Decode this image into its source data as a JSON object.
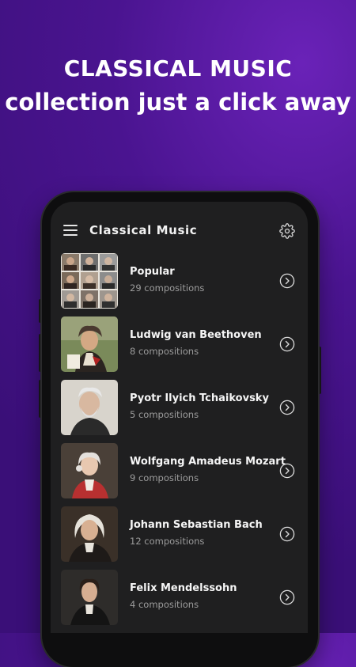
{
  "promo": {
    "headline": "CLASSICAL MUSIC",
    "subheadline": "collection just a click away"
  },
  "app": {
    "title": "Classical Music",
    "menu_icon": "hamburger-menu-icon",
    "settings_icon": "gear-icon"
  },
  "composers": [
    {
      "name": "Popular",
      "count": "29 compositions"
    },
    {
      "name": "Ludwig van Beethoven",
      "count": "8 compositions"
    },
    {
      "name": "Pyotr Ilyich Tchaikovsky",
      "count": "5 compositions"
    },
    {
      "name": "Wolfgang Amadeus Mozart",
      "count": "9 compositions"
    },
    {
      "name": "Johann Sebastian Bach",
      "count": "12 compositions"
    },
    {
      "name": "Felix Mendelssohn",
      "count": "4 compositions"
    }
  ],
  "colors": {
    "background": "#4a1490",
    "screen": "#1f1f20",
    "text_primary": "#f5f5f5",
    "text_secondary": "#9c9c9c"
  }
}
